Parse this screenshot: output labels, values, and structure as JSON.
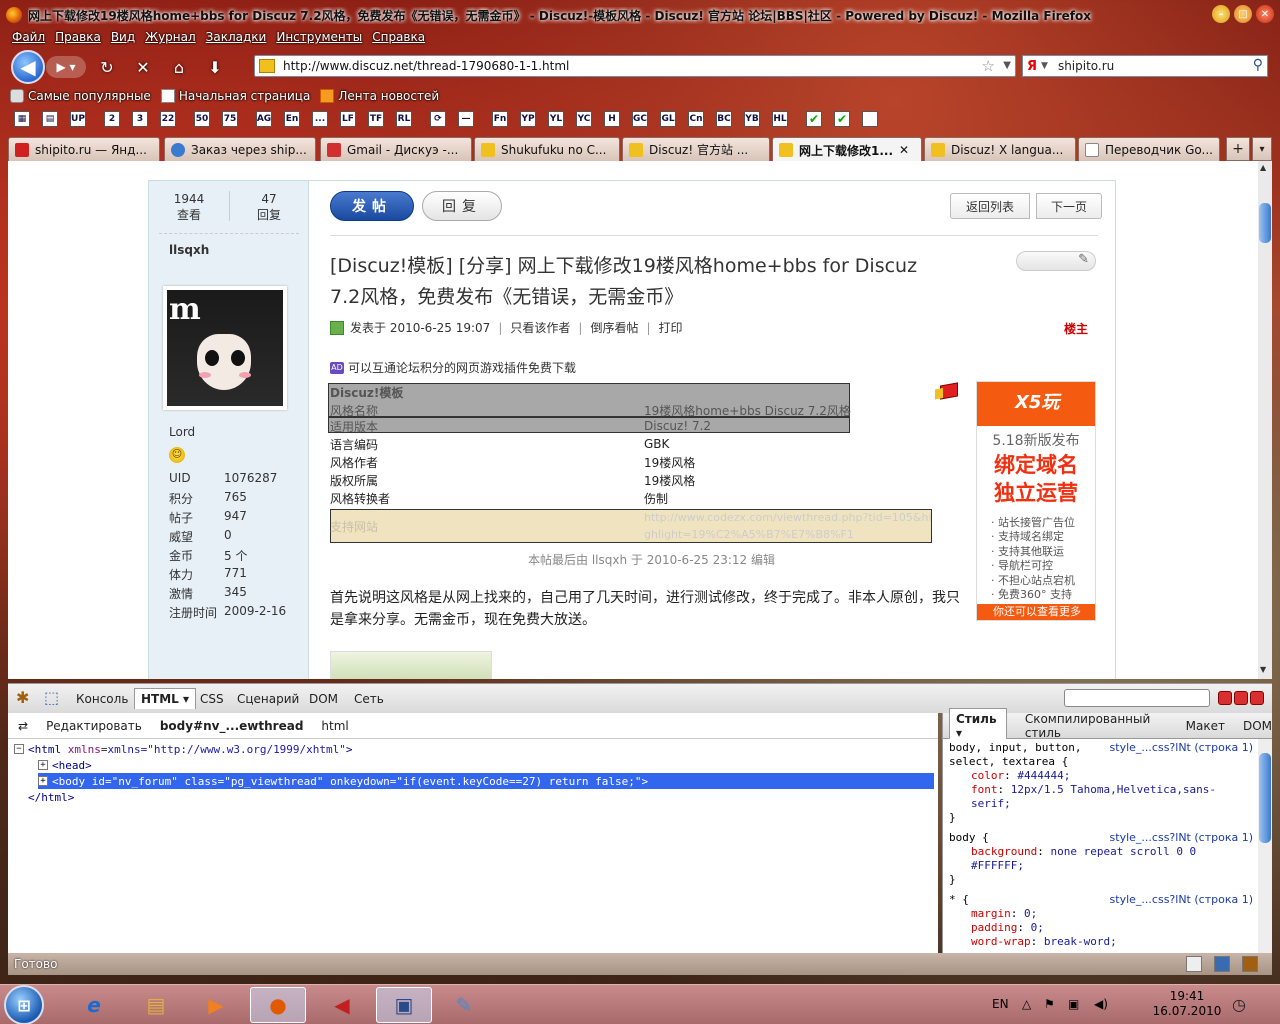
{
  "window": {
    "title": "网上下载修改19楼风格home+bbs for Discuz 7.2风格，免费发布《无错误，无需金币》 - Discuz!-模板风格 - Discuz! 官方站 论坛|BBS|社区 - Powered by Discuz! - Mozilla Firefox"
  },
  "menu": [
    "Файл",
    "Правка",
    "Вид",
    "Журнал",
    "Закладки",
    "Инструменты",
    "Справка"
  ],
  "nav": {
    "url": "http://www.discuz.net/thread-1790680-1-1.html",
    "search_value": "shipito.ru",
    "search_engine": "Я"
  },
  "bookmarks": [
    "Самые популярные",
    "Начальная страница",
    "Лента новостей"
  ],
  "toolbar2": [
    "UP",
    "2",
    "3",
    "22",
    "50",
    "75",
    "AG",
    "En",
    "...",
    "LF",
    "TF",
    "RL",
    "⟳",
    "—",
    "Fn",
    "YP",
    "YL",
    "YC",
    "H",
    "GC",
    "GL",
    "Cn",
    "BC",
    "YB",
    "HL"
  ],
  "tabs": [
    {
      "label": "shipito.ru — Янд...",
      "color": "#d02020"
    },
    {
      "label": "Заказ через ship...",
      "color": "#3a7ad0"
    },
    {
      "label": "Gmail - Дискуэ -...",
      "color": "#d03030"
    },
    {
      "label": "Shukufuku no C...",
      "color": "#f0c020"
    },
    {
      "label": "Discuz! 官方站 ...",
      "color": "#f0c020"
    },
    {
      "label": "网上下载修改1...",
      "color": "#f0c020"
    },
    {
      "label": "Discuz! X langua...",
      "color": "#f0c020"
    },
    {
      "label": "Переводчик Go...",
      "color": "#ffffff"
    }
  ],
  "post": {
    "views_count": "1944",
    "views_label": "查看",
    "replies_count": "47",
    "replies_label": "回复",
    "author": "llsqxh",
    "rank": "Lord",
    "profile": [
      {
        "k": "UID",
        "v": "1076287"
      },
      {
        "k": "积分",
        "v": "765"
      },
      {
        "k": "帖子",
        "v": "947"
      },
      {
        "k": "威望",
        "v": "0"
      },
      {
        "k": "金币",
        "v": "5 个"
      },
      {
        "k": "体力",
        "v": "771"
      },
      {
        "k": "激情",
        "v": "345"
      },
      {
        "k": "注册时间",
        "v": "2009-2-16"
      }
    ],
    "btn_post": "发帖",
    "btn_reply": "回复",
    "btn_back": "返回列表",
    "btn_next": "下一页",
    "title": "[Discuz!模板] [分享] 网上下载修改19楼风格home+bbs for Discuz 7.2风格，免费发布《无错误，无需金币》",
    "meta_posted": "发表于 2010-6-25 19:07",
    "meta_only": "只看该作者",
    "meta_reverse": "倒序看帖",
    "meta_print": "打印",
    "louzhu": "楼主",
    "ad_line": "可以互通论坛积分的网页游戏插件免费下载",
    "ad_badge": "AD",
    "table_head": "Discuz!模板",
    "table": [
      {
        "k": "风格名称",
        "v": "19楼风格home+bbs Discuz 7.2风格"
      },
      {
        "k": "适用版本",
        "v": "Discuz! 7.2"
      },
      {
        "k": "语言编码",
        "v": "GBK"
      },
      {
        "k": "风格作者",
        "v": "19楼风格"
      },
      {
        "k": "版权所属",
        "v": "19楼风格"
      },
      {
        "k": "风格转换者",
        "v": "伤制"
      }
    ],
    "support_label": "支持网站",
    "support_url": "http://www.codezx.com/viewthread.php?tid=105&highlight=19%C2%A5%B7%E7%B8%F1",
    "edit_note": "本帖最后由 llsqxh 于 2010-6-25 23:12 编辑",
    "body": "首先说明这风格是从网上找来的，自己用了几天时间，进行测试修改，终于完成了。非本人原创，我只是拿来分享。无需金币，现在免费大放送。"
  },
  "sidead": {
    "logo": "X5玩",
    "sub": "5.18新版发布",
    "big1": "绑定域名",
    "big2": "独立运营",
    "items": [
      "· 站长接管广告位",
      "· 支持域名绑定",
      "· 支持其他联运",
      "· 导航栏可控",
      "· 不担心站点宕机",
      "· 免费360° 支持"
    ],
    "bottom": "你还可以查看更多"
  },
  "firebug": {
    "tabs": [
      "Консоль",
      "HTML",
      "CSS",
      "Сценарий",
      "DOM",
      "Сеть"
    ],
    "crumbs_edit": "Редактировать",
    "crumb_body": "body#nv_...ewthread",
    "crumb_html": "html",
    "side_tabs": [
      "Стиль",
      "Скомпилированный стиль",
      "Макет",
      "DOM"
    ],
    "tree": {
      "html_open": "xmlns=\"http://www.w3.org/1999/xhtml\"",
      "head": "head",
      "body_id": "\"nv_forum\"",
      "body_class": "\"pg_viewthread\"",
      "body_onkeydown": "\"if(event.keyCode==27) return false;\"",
      "html_close": "</html>"
    },
    "css_src": "style_...css?lNt (строка 1)",
    "css1_sel": "body, input, button,",
    "css1_sel2": "select, textarea {",
    "css1_color": "#444444;",
    "css1_font": "12px/1.5 Tahoma,Helvetica,sans-",
    "css1_font2": "serif;",
    "css2_sel": "body {",
    "css2_bg": "none repeat scroll 0 0",
    "css2_bg2": "#FFFFFF;",
    "css3_sel": "* {",
    "css3_margin": "0;",
    "css3_padding": "0;",
    "css3_wrap": "break-word;"
  },
  "status": "Готово",
  "taskbar": {
    "lang": "EN",
    "time": "19:41",
    "date": "16.07.2010"
  }
}
